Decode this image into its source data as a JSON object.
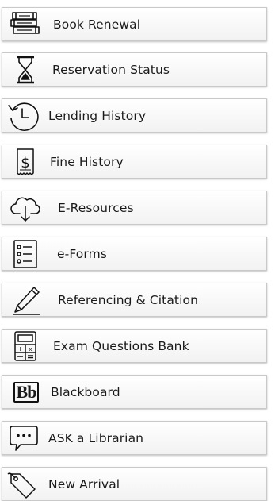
{
  "menu": {
    "items": [
      {
        "label": "Book Renewal",
        "icon": "books-stack-icon"
      },
      {
        "label": "Reservation Status",
        "icon": "hourglass-icon"
      },
      {
        "label": "Lending History",
        "icon": "history-clock-icon"
      },
      {
        "label": "Fine History",
        "icon": "receipt-dollar-icon"
      },
      {
        "label": "E-Resources",
        "icon": "cloud-download-icon"
      },
      {
        "label": "e-Forms",
        "icon": "checklist-icon"
      },
      {
        "label": "Referencing & Citation",
        "icon": "pencil-icon"
      },
      {
        "label": "Exam Questions Bank",
        "icon": "calculator-icon"
      },
      {
        "label": "Blackboard",
        "icon": "blackboard-logo-icon"
      },
      {
        "label": "ASK a Librarian",
        "icon": "chat-bubble-icon"
      },
      {
        "label": "New Arrival",
        "icon": "tag-icon"
      }
    ],
    "blackboard_logo_text": "Bb"
  }
}
